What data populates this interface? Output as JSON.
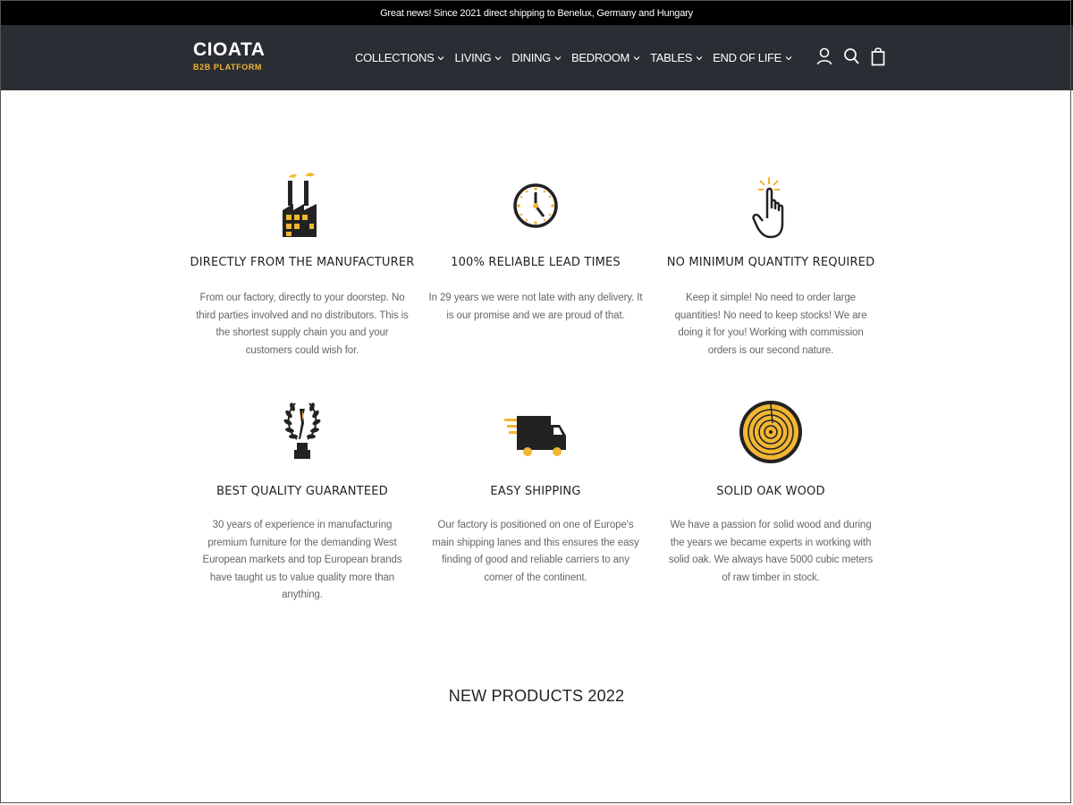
{
  "announcement": "Great news! Since 2021 direct shipping to Benelux, Germany and Hungary",
  "logo": {
    "name": "CIOATA",
    "sub": "B2B PLATFORM"
  },
  "nav": [
    {
      "label": "COLLECTIONS"
    },
    {
      "label": "LIVING"
    },
    {
      "label": "DINING"
    },
    {
      "label": "BEDROOM"
    },
    {
      "label": "TABLES"
    },
    {
      "label": "END OF LIFE"
    }
  ],
  "header_icons": [
    "account-icon",
    "search-icon",
    "cart-icon"
  ],
  "colors": {
    "accent": "#f2b632",
    "header_bg": "#2a2d33",
    "announcement_bg": "#000000"
  },
  "features": [
    {
      "icon": "factory-icon",
      "title": "DIRECTLY FROM THE MANUFACTURER",
      "description": "From our factory, directly to your doorstep. No third parties involved and no distributors. This is the shortest supply chain you and your customers could wish for."
    },
    {
      "icon": "clock-icon",
      "title": "100% RELIABLE LEAD TIMES",
      "description": "In 29 years we were not late with any delivery. It is our promise and we are proud of that."
    },
    {
      "icon": "pointer-hand-icon",
      "title": "NO MINIMUM QUANTITY REQUIRED",
      "description": "Keep it simple! No need to order large quantities! No need to keep stocks! We are doing it for you! Working with commission orders is our second nature."
    },
    {
      "icon": "laurel-trophy-icon",
      "title": "BEST QUALITY GUARANTEED",
      "description": "30 years of experience in manufacturing premium furniture for the demanding West European markets and top European brands have taught us to value quality more than anything."
    },
    {
      "icon": "delivery-truck-icon",
      "title": "EASY SHIPPING",
      "description": "Our factory is positioned on one of Europe's main shipping lanes and this ensures the easy finding of good and reliable carriers to any corner of the continent."
    },
    {
      "icon": "wood-log-icon",
      "title": "SOLID OAK WOOD",
      "description": "We have a passion for solid wood and during the years we became experts in working with solid oak. We always have 5000 cubic meters of raw timber in stock."
    }
  ],
  "section_title": "NEW PRODUCTS 2022"
}
